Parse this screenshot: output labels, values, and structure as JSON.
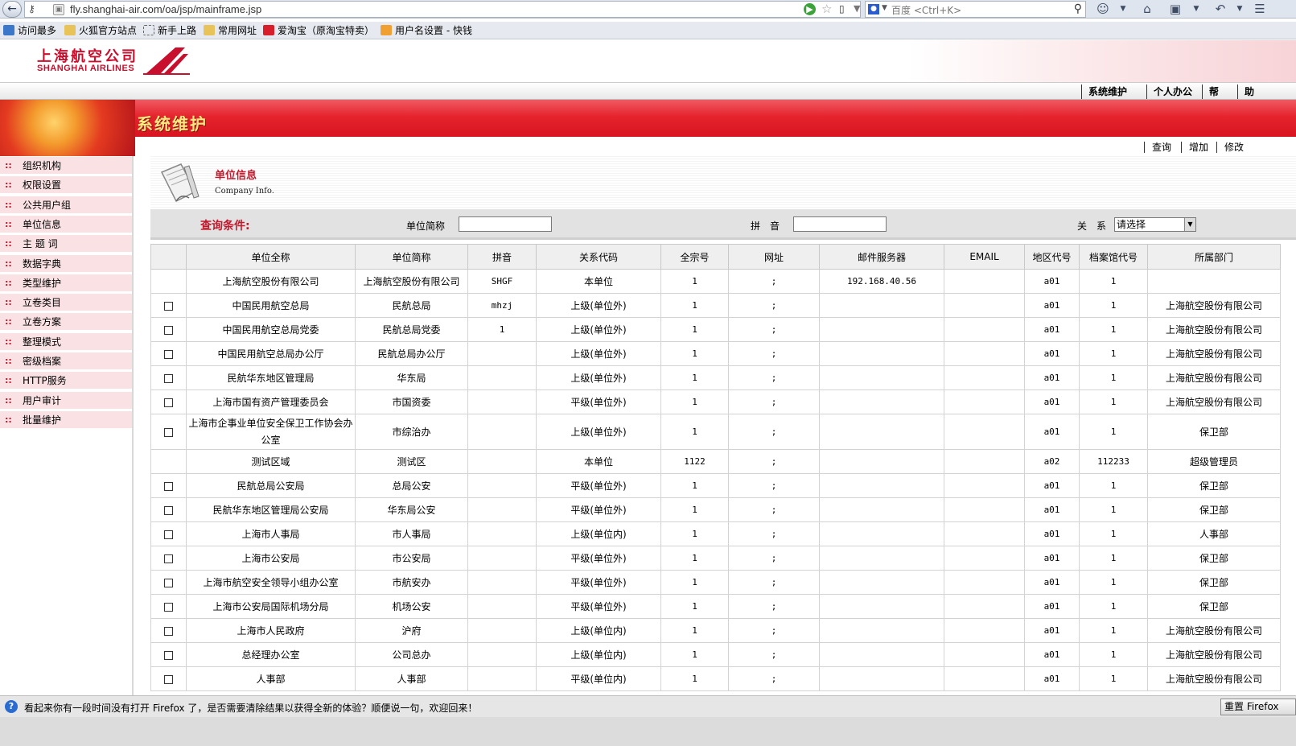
{
  "browser": {
    "url": "fly.shanghai-air.com/oa/jsp/mainframe.jsp",
    "search_placeholder": "百度 <Ctrl+K>",
    "bookmarks": [
      "访问最多",
      "火狐官方站点",
      "新手上路",
      "常用网址",
      "爱淘宝（原淘宝特卖）",
      "用户名设置 - 快钱"
    ]
  },
  "header": {
    "logo_cn": "上海航空公司",
    "logo_en": "SHANGHAI AIRLINES",
    "menu": [
      "系统维护",
      "个人办公",
      "帮",
      "助"
    ]
  },
  "banner": {
    "title": "系统维护"
  },
  "sidebar": {
    "items": [
      "组织机构",
      "权限设置",
      "公共用户组",
      "单位信息",
      "主 题 词",
      "数据字典",
      "类型维护",
      "立卷类目",
      "立卷方案",
      "整理模式",
      "密级档案",
      "HTTP服务",
      "用户审计",
      "批量维护"
    ]
  },
  "actions": [
    "查询",
    "增加",
    "修改"
  ],
  "info": {
    "title": "单位信息",
    "subtitle": "Company Info."
  },
  "query": {
    "title": "查询条件:",
    "abbr_label": "单位简称",
    "abbr_value": "",
    "pinyin_label": "拼　音",
    "pinyin_value": "",
    "relation_label": "关　系",
    "relation_value": "请选择"
  },
  "table": {
    "columns": [
      "",
      "单位全称",
      "单位简称",
      "拼音",
      "关系代码",
      "全宗号",
      "网址",
      "邮件服务器",
      "EMAIL",
      "地区代号",
      "档案馆代号",
      "所属部门"
    ],
    "rows": [
      {
        "check": false,
        "name": "上海航空股份有限公司",
        "abbr": "上海航空股份有限公司",
        "pinyin": "SHGF",
        "relation": "本单位",
        "fonds": "1",
        "url": ";",
        "mail": "192.168.40.56",
        "email": "",
        "area": "a01",
        "archive": "1",
        "dept": ""
      },
      {
        "check": true,
        "name": "中国民用航空总局",
        "abbr": "民航总局",
        "pinyin": "mhzj",
        "relation": "上级(单位外)",
        "fonds": "1",
        "url": ";",
        "mail": "",
        "email": "",
        "area": "a01",
        "archive": "1",
        "dept": "上海航空股份有限公司"
      },
      {
        "check": true,
        "name": "中国民用航空总局党委",
        "abbr": "民航总局党委",
        "pinyin": "1",
        "relation": "上级(单位外)",
        "fonds": "1",
        "url": ";",
        "mail": "",
        "email": "",
        "area": "a01",
        "archive": "1",
        "dept": "上海航空股份有限公司"
      },
      {
        "check": true,
        "name": "中国民用航空总局办公厅",
        "abbr": "民航总局办公厅",
        "pinyin": "",
        "relation": "上级(单位外)",
        "fonds": "1",
        "url": ";",
        "mail": "",
        "email": "",
        "area": "a01",
        "archive": "1",
        "dept": "上海航空股份有限公司"
      },
      {
        "check": true,
        "name": "民航华东地区管理局",
        "abbr": "华东局",
        "pinyin": "",
        "relation": "上级(单位外)",
        "fonds": "1",
        "url": ";",
        "mail": "",
        "email": "",
        "area": "a01",
        "archive": "1",
        "dept": "上海航空股份有限公司"
      },
      {
        "check": true,
        "name": "上海市国有资产管理委员会",
        "abbr": "市国资委",
        "pinyin": "",
        "relation": "平级(单位外)",
        "fonds": "1",
        "url": ";",
        "mail": "",
        "email": "",
        "area": "a01",
        "archive": "1",
        "dept": "上海航空股份有限公司"
      },
      {
        "check": true,
        "name": "上海市企事业单位安全保卫工作协会办公室",
        "abbr": "市综治办",
        "pinyin": "",
        "relation": "上级(单位外)",
        "fonds": "1",
        "url": ";",
        "mail": "",
        "email": "",
        "area": "a01",
        "archive": "1",
        "dept": "保卫部"
      },
      {
        "check": false,
        "name": "测试区域",
        "abbr": "测试区",
        "pinyin": "",
        "relation": "本单位",
        "fonds": "1122",
        "url": ";",
        "mail": "",
        "email": "",
        "area": "a02",
        "archive": "112233",
        "dept": "超级管理员"
      },
      {
        "check": true,
        "name": "民航总局公安局",
        "abbr": "总局公安",
        "pinyin": "",
        "relation": "平级(单位外)",
        "fonds": "1",
        "url": ";",
        "mail": "",
        "email": "",
        "area": "a01",
        "archive": "1",
        "dept": "保卫部"
      },
      {
        "check": true,
        "name": "民航华东地区管理局公安局",
        "abbr": "华东局公安",
        "pinyin": "",
        "relation": "平级(单位外)",
        "fonds": "1",
        "url": ";",
        "mail": "",
        "email": "",
        "area": "a01",
        "archive": "1",
        "dept": "保卫部"
      },
      {
        "check": true,
        "name": "上海市人事局",
        "abbr": "市人事局",
        "pinyin": "",
        "relation": "上级(单位内)",
        "fonds": "1",
        "url": ";",
        "mail": "",
        "email": "",
        "area": "a01",
        "archive": "1",
        "dept": "人事部"
      },
      {
        "check": true,
        "name": "上海市公安局",
        "abbr": "市公安局",
        "pinyin": "",
        "relation": "平级(单位外)",
        "fonds": "1",
        "url": ";",
        "mail": "",
        "email": "",
        "area": "a01",
        "archive": "1",
        "dept": "保卫部"
      },
      {
        "check": true,
        "name": "上海市航空安全领导小组办公室",
        "abbr": "市航安办",
        "pinyin": "",
        "relation": "平级(单位外)",
        "fonds": "1",
        "url": ";",
        "mail": "",
        "email": "",
        "area": "a01",
        "archive": "1",
        "dept": "保卫部"
      },
      {
        "check": true,
        "name": "上海市公安局国际机场分局",
        "abbr": "机场公安",
        "pinyin": "",
        "relation": "平级(单位外)",
        "fonds": "1",
        "url": ";",
        "mail": "",
        "email": "",
        "area": "a01",
        "archive": "1",
        "dept": "保卫部"
      },
      {
        "check": true,
        "name": "上海市人民政府",
        "abbr": "沪府",
        "pinyin": "",
        "relation": "上级(单位内)",
        "fonds": "1",
        "url": ";",
        "mail": "",
        "email": "",
        "area": "a01",
        "archive": "1",
        "dept": "上海航空股份有限公司"
      },
      {
        "check": true,
        "name": "总经理办公室",
        "abbr": "公司总办",
        "pinyin": "",
        "relation": "上级(单位内)",
        "fonds": "1",
        "url": ";",
        "mail": "",
        "email": "",
        "area": "a01",
        "archive": "1",
        "dept": "上海航空股份有限公司"
      },
      {
        "check": true,
        "name": "人事部",
        "abbr": "人事部",
        "pinyin": "",
        "relation": "平级(单位内)",
        "fonds": "1",
        "url": ";",
        "mail": "",
        "email": "",
        "area": "a01",
        "archive": "1",
        "dept": "上海航空股份有限公司"
      }
    ]
  },
  "notification": {
    "text": "看起来你有一段时间没有打开 Firefox 了，是否需要清除结果以获得全新的体验？顺便说一句，欢迎回来！",
    "button": "重置 Firefox"
  },
  "colors": {
    "brand_red": "#c8102e",
    "banner_red": "#e5232d",
    "sidebar_pink": "#f9e1e4"
  }
}
